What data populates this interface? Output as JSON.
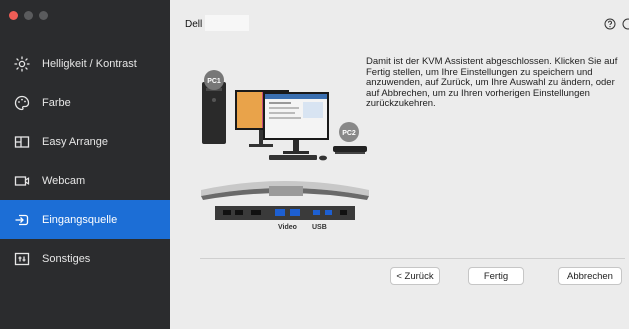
{
  "sidebar": {
    "items": [
      {
        "label": "Helligkeit / Kontrast",
        "icon": "brightness-icon"
      },
      {
        "label": "Farbe",
        "icon": "palette-icon"
      },
      {
        "label": "Easy Arrange",
        "icon": "layout-icon"
      },
      {
        "label": "Webcam",
        "icon": "webcam-icon"
      },
      {
        "label": "Eingangsquelle",
        "icon": "input-source-icon",
        "active": true
      },
      {
        "label": "Sonstiges",
        "icon": "other-settings-icon"
      }
    ]
  },
  "header": {
    "brand": "Dell"
  },
  "illustration": {
    "pc1_label": "PC1",
    "pc2_label": "PC2",
    "port_video_label": "Video",
    "port_usb_label": "USB"
  },
  "content": {
    "description": "Damit ist der KVM Assistent abgeschlossen. Klicken Sie auf Fertig stellen, um Ihre Einstellungen zu speichern und anzuwenden, auf Zurück, um Ihre Auswahl zu ändern, oder auf Abbrechen, um zu Ihren vorherigen Einstellungen zurückzukehren."
  },
  "buttons": {
    "back": "< Zurück",
    "finish": "Fertig",
    "cancel": "Abbrechen"
  },
  "colors": {
    "sidebar_bg": "#2b2c2e",
    "active_blue": "#1c6ed6",
    "close_red": "#ee5d56"
  }
}
